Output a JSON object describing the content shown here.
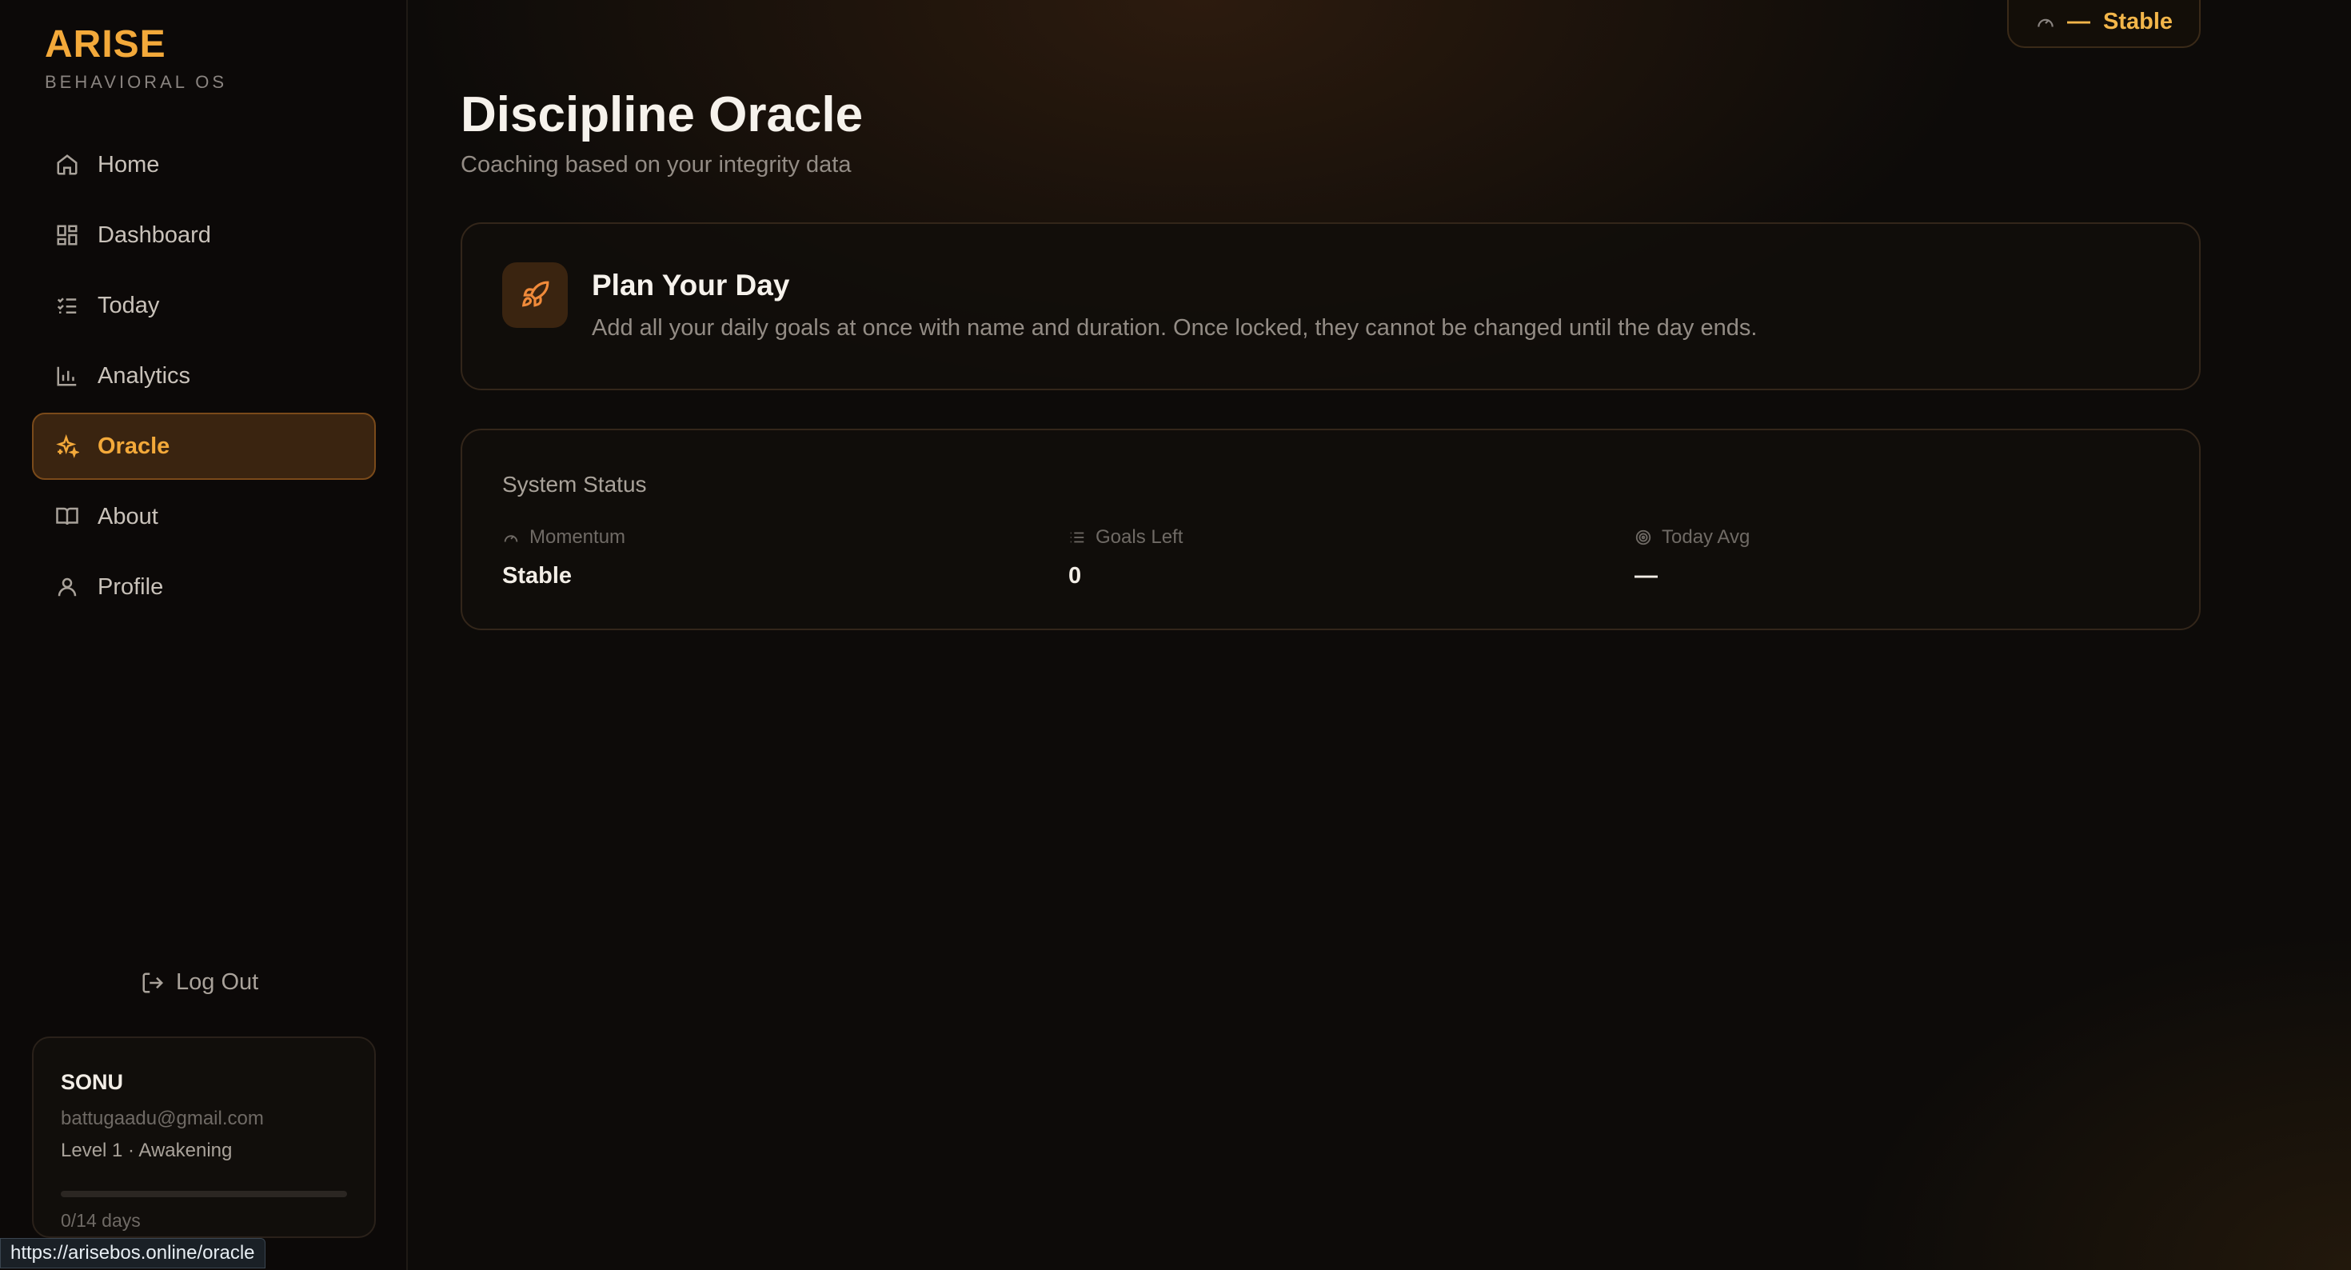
{
  "brand": {
    "title": "ARISE",
    "subtitle": "BEHAVIORAL OS"
  },
  "nav": {
    "items": [
      {
        "label": "Home",
        "icon": "home-icon"
      },
      {
        "label": "Dashboard",
        "icon": "grid-icon"
      },
      {
        "label": "Today",
        "icon": "checklist-icon"
      },
      {
        "label": "Analytics",
        "icon": "bar-chart-icon"
      },
      {
        "label": "Oracle",
        "icon": "sparkles-icon",
        "active": true
      },
      {
        "label": "About",
        "icon": "book-icon"
      },
      {
        "label": "Profile",
        "icon": "user-icon"
      }
    ]
  },
  "logout": {
    "label": "Log Out"
  },
  "user": {
    "name": "SONU",
    "email": "battugaadu@gmail.com",
    "level": "Level 1 · Awakening",
    "progress_days": "0/14 days",
    "progress_fraction": 0
  },
  "status_pill": {
    "dash": "—",
    "label": "Stable"
  },
  "page": {
    "title": "Discipline Oracle",
    "subtitle": "Coaching based on your integrity data"
  },
  "plan_card": {
    "title": "Plan Your Day",
    "description": "Add all your daily goals at once with name and duration. Once locked, they cannot be changed until the day ends."
  },
  "system_status": {
    "title": "System Status",
    "stats": [
      {
        "label": "Momentum",
        "value": "Stable",
        "icon": "gauge-icon"
      },
      {
        "label": "Goals Left",
        "value": "0",
        "icon": "list-icon"
      },
      {
        "label": "Today Avg",
        "value": "—",
        "icon": "target-icon"
      }
    ]
  },
  "url_tooltip": "https://arisebos.online/oracle",
  "colors": {
    "accent": "#f3a93a",
    "rocket": "#f08a3a",
    "background": "#0d0b09"
  }
}
